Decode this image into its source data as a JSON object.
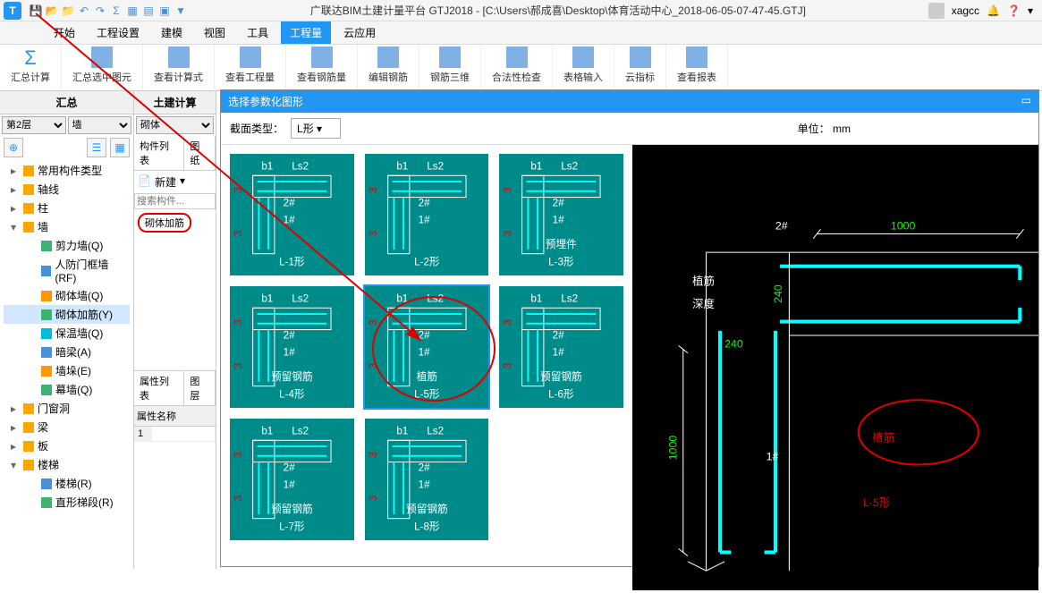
{
  "app": {
    "title": "广联达BIM土建计量平台 GTJ2018 - [C:\\Users\\郝成喜\\Desktop\\体育活动中心_2018-06-05-07-47-45.GTJ]",
    "user": "xagcc"
  },
  "menu": {
    "items": [
      "开始",
      "工程设置",
      "建模",
      "视图",
      "工具",
      "工程量",
      "云应用"
    ],
    "active": 5
  },
  "ribbon": {
    "items": [
      "汇总计算",
      "汇总选中图元",
      "查看计算式",
      "查看工程量",
      "查看钢筋量",
      "编辑钢筋",
      "钢筋三维",
      "合法性检查",
      "表格输入",
      "云指标",
      "查看报表"
    ]
  },
  "left": {
    "title": "汇总",
    "floor": "第2层",
    "cat": "墙",
    "tree": [
      {
        "exp": "▸",
        "icon": "ti-folder",
        "label": "常用构件类型",
        "lvl": 0
      },
      {
        "exp": "▸",
        "icon": "ti-folder",
        "label": "轴线",
        "lvl": 0
      },
      {
        "exp": "▸",
        "icon": "ti-folder",
        "label": "柱",
        "lvl": 0
      },
      {
        "exp": "▾",
        "icon": "ti-folder",
        "label": "墙",
        "lvl": 0
      },
      {
        "exp": "",
        "icon": "ti-green",
        "label": "剪力墙(Q)",
        "lvl": 1
      },
      {
        "exp": "",
        "icon": "ti-blue",
        "label": "人防门框墙(RF)",
        "lvl": 1
      },
      {
        "exp": "",
        "icon": "ti-orange",
        "label": "砌体墙(Q)",
        "lvl": 1
      },
      {
        "exp": "",
        "icon": "ti-green",
        "label": "砌体加筋(Y)",
        "lvl": 1,
        "sel": true
      },
      {
        "exp": "",
        "icon": "ti-cyan",
        "label": "保温墙(Q)",
        "lvl": 1
      },
      {
        "exp": "",
        "icon": "ti-blue",
        "label": "暗梁(A)",
        "lvl": 1
      },
      {
        "exp": "",
        "icon": "ti-orange",
        "label": "墙垛(E)",
        "lvl": 1
      },
      {
        "exp": "",
        "icon": "ti-green",
        "label": "幕墙(Q)",
        "lvl": 1
      },
      {
        "exp": "▸",
        "icon": "ti-folder",
        "label": "门窗洞",
        "lvl": 0
      },
      {
        "exp": "▸",
        "icon": "ti-folder",
        "label": "梁",
        "lvl": 0
      },
      {
        "exp": "▸",
        "icon": "ti-folder",
        "label": "板",
        "lvl": 0
      },
      {
        "exp": "▾",
        "icon": "ti-folder",
        "label": "楼梯",
        "lvl": 0
      },
      {
        "exp": "",
        "icon": "ti-blue",
        "label": "楼梯(R)",
        "lvl": 1
      },
      {
        "exp": "",
        "icon": "ti-green",
        "label": "直形梯段(R)",
        "lvl": 1
      }
    ]
  },
  "mid": {
    "title": "土建计算",
    "sub": "砌体",
    "tab1": "构件列表",
    "tab2": "图纸",
    "newbtn": "新建",
    "search_ph": "搜索构件...",
    "highlight": "砌体加筋",
    "prop_tab1": "属性列表",
    "prop_tab2": "图层",
    "prop_header": "属性名称",
    "row1": "1"
  },
  "dialog": {
    "title": "选择参数化图形",
    "section_label": "截面类型：",
    "section_value": "L形",
    "unit_label": "单位：",
    "unit_value": "mm",
    "thumbs": [
      {
        "label": "L-1形",
        "sub": ""
      },
      {
        "label": "L-2形",
        "sub": ""
      },
      {
        "label": "L-3形",
        "sub": "预埋件"
      },
      {
        "label": "L-4形",
        "sub": "预留钢筋"
      },
      {
        "label": "L-5形",
        "sub": "植筋",
        "sel": true
      },
      {
        "label": "L-6形",
        "sub": "预留钢筋"
      },
      {
        "label": "L-7形",
        "sub": "预留钢筋"
      },
      {
        "label": "L-8形",
        "sub": "预留钢筋"
      }
    ],
    "preview": {
      "dim_top": "2#",
      "dim_right": "1000",
      "dim_v1": "240",
      "dim_v2": "240",
      "dim_left": "1000",
      "dim_mid": "1#",
      "label_depth": "植筋\n深度",
      "big_label": "植筋",
      "type_label": "L-5形"
    }
  }
}
